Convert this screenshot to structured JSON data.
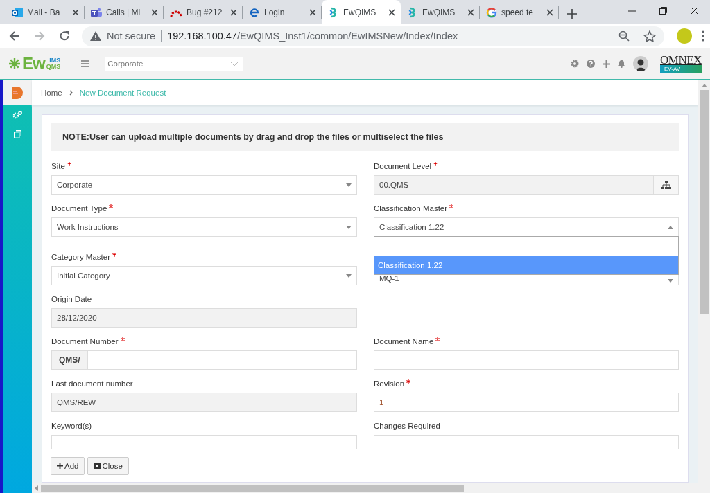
{
  "browser": {
    "tabs": [
      {
        "title": "Mail - Ba",
        "kind": "mail",
        "selected": false
      },
      {
        "title": "Calls | Mi",
        "kind": "calls",
        "selected": false
      },
      {
        "title": "Bug #212",
        "kind": "bug",
        "selected": false
      },
      {
        "title": "Login",
        "kind": "login",
        "selected": false
      },
      {
        "title": "EwQIMS",
        "kind": "app",
        "selected": true
      },
      {
        "title": "EwQIMS",
        "kind": "app",
        "selected": false
      },
      {
        "title": "speed te",
        "kind": "search",
        "selected": false
      }
    ],
    "address": {
      "security": "Not secure",
      "host": "192.168.100.47",
      "path": "/EwQIMS_Inst1/common/EwIMSNew/Index/Index"
    }
  },
  "app_header": {
    "logo": {
      "main": "Ew",
      "top": "IMS",
      "bottom": "QMS"
    },
    "site_selector": "Corporate",
    "brand": {
      "name": "OMNEX",
      "badge": "EV-AV"
    }
  },
  "breadcrumb": [
    "Home",
    "New Document Request"
  ],
  "note": "NOTE:User can upload multiple documents by drag and drop the files or multiselect the files",
  "rows": [
    {
      "left": {
        "label": "Site",
        "required": true,
        "kind": "select",
        "value": "Corporate",
        "open": false
      },
      "right": {
        "label": "Document Level",
        "required": true,
        "kind": "picker",
        "value": "00.QMS"
      }
    },
    {
      "left": {
        "label": "Document Type",
        "required": true,
        "kind": "select",
        "value": "Work Instructions",
        "open": false
      },
      "right": {
        "label": "Classification Master",
        "required": true,
        "kind": "select",
        "value": "Classification 1.22",
        "open": true,
        "options": [
          {
            "label": "Classification 1.22",
            "selected": true
          }
        ]
      }
    },
    {
      "left": {
        "label": "Category Master",
        "required": true,
        "kind": "select",
        "value": "Initial Category",
        "open": false
      },
      "right": {
        "kind": "select",
        "value": "MQ-1",
        "open": false
      }
    },
    {
      "left": {
        "label": "Origin Date",
        "required": false,
        "kind": "readonly",
        "value": "28/12/2020"
      }
    },
    {
      "left": {
        "label": "Document Number",
        "required": true,
        "kind": "prefixed",
        "prefix": "QMS/"
      },
      "right": {
        "label": "Document Name",
        "required": true,
        "kind": "input"
      }
    },
    {
      "left": {
        "label": "Last document number",
        "required": false,
        "kind": "readonly",
        "value": "QMS/REW"
      },
      "right": {
        "label": "Revision",
        "required": true,
        "kind": "input",
        "value": "1"
      }
    },
    {
      "left": {
        "label": "Keyword(s)",
        "required": false,
        "kind": "input"
      },
      "right": {
        "label": "Changes Required",
        "required": false,
        "kind": "input"
      }
    }
  ],
  "buttons": [
    {
      "label": "Add",
      "kind": "add"
    },
    {
      "label": "Close",
      "kind": "close"
    }
  ]
}
